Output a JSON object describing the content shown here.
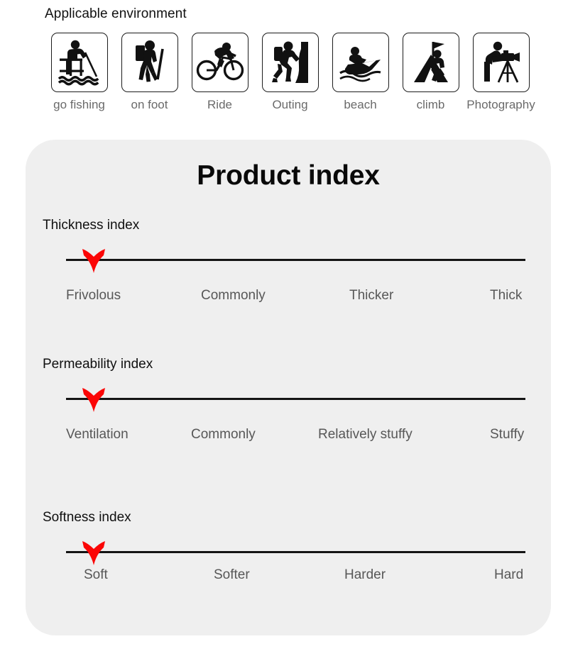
{
  "environment": {
    "title": "Applicable environment",
    "items": [
      {
        "icon": "fishing-icon",
        "label": "go fishing"
      },
      {
        "icon": "hiking-icon",
        "label": "on foot"
      },
      {
        "icon": "cycling-icon",
        "label": "Ride"
      },
      {
        "icon": "rock-climb-icon",
        "label": "Outing"
      },
      {
        "icon": "jet-ski-icon",
        "label": "beach"
      },
      {
        "icon": "mountain-flag-icon",
        "label": "climb"
      },
      {
        "icon": "camera-tripod-icon",
        "label": "Photography"
      }
    ]
  },
  "panel": {
    "title": "Product index",
    "background_color": "#efefef",
    "marker_color": "#fb0606",
    "line_color": "#141414",
    "blocks": [
      {
        "heading": "Thickness index",
        "marker_position_percent": 6,
        "labels": [
          "Frivolous",
          "Commonly",
          "Thicker",
          "Thick"
        ]
      },
      {
        "heading": "Permeability index",
        "marker_position_percent": 6,
        "labels": [
          "Ventilation",
          "Commonly",
          "Relatively stuffy",
          "Stuffy"
        ]
      },
      {
        "heading": "Softness index",
        "marker_position_percent": 6,
        "labels": [
          "Soft",
          "Softer",
          "Harder",
          "Hard"
        ]
      }
    ]
  }
}
